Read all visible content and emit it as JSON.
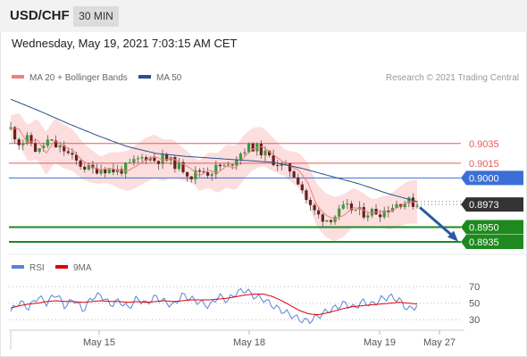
{
  "header": {
    "pair": "USD/CHF",
    "timeframe": "30 MIN",
    "datetime": "Wednesday, May 19, 2021 7:03:15 AM CET"
  },
  "legend": {
    "ma20": {
      "label": "MA 20 + Bollinger Bands",
      "color": "#f08080"
    },
    "ma50": {
      "label": "MA 50",
      "color": "#2c4f8c"
    },
    "rsi": {
      "label": "RSI",
      "color": "#5b82d8"
    },
    "rsi_ma": {
      "label": "9MA",
      "color": "#e00000"
    }
  },
  "credit": "Research © 2021 Trading Central",
  "chart_data": [
    {
      "type": "candlestick",
      "ylim": [
        0.8925,
        0.9092
      ],
      "x_labels": [
        "May 15",
        "May 18",
        "May 19",
        "May 27"
      ],
      "levels": [
        {
          "value": 0.9035,
          "label": "0.9035",
          "kind": "resistance",
          "color": "#e85a5a"
        },
        {
          "value": 0.9015,
          "label": "0.9015",
          "kind": "resistance",
          "color": "#e85a5a"
        },
        {
          "value": 0.9,
          "label": "0.9000",
          "kind": "pivot",
          "color": "#3b6fd6"
        },
        {
          "value": 0.895,
          "label": "0.8950",
          "kind": "target",
          "color": "#1e8a1e"
        },
        {
          "value": 0.8935,
          "label": "0.8935",
          "kind": "target",
          "color": "#1e8a1e"
        }
      ],
      "last_price": {
        "value": 0.8973,
        "label": "0.8973",
        "color": "#333333"
      },
      "close_path": [
        0.905,
        0.9035,
        0.904,
        0.9025,
        0.9038,
        0.9032,
        0.9028,
        0.9018,
        0.9012,
        0.9008,
        0.901,
        0.9008,
        0.9007,
        0.9012,
        0.9018,
        0.9022,
        0.9018,
        0.902,
        0.9015,
        0.901,
        0.9002,
        0.9008,
        0.9005,
        0.9012,
        0.901,
        0.9022,
        0.903,
        0.9032,
        0.9025,
        0.9018,
        0.9012,
        0.9008,
        0.8995,
        0.8972,
        0.8962,
        0.8958,
        0.8962,
        0.897,
        0.8968,
        0.8964,
        0.8966,
        0.8965,
        0.897,
        0.8975,
        0.8976,
        0.8973
      ],
      "ma50_path": [
        0.908,
        0.9068,
        0.9055,
        0.9043,
        0.9032,
        0.9025,
        0.9022,
        0.902,
        0.9018,
        0.9016,
        0.901,
        0.9002,
        0.8994,
        0.8984,
        0.8976
      ],
      "band_width": 0.0018,
      "projection": {
        "from": 0.897,
        "to": 0.8938
      }
    },
    {
      "type": "line",
      "name": "RSI panel",
      "ylim": [
        15,
        80
      ],
      "y_ticks": [
        {
          "value": 70,
          "label": "70"
        },
        {
          "value": 50,
          "label": "50"
        },
        {
          "value": 30,
          "label": "30"
        }
      ],
      "rsi": [
        40,
        52,
        44,
        58,
        50,
        62,
        46,
        55,
        41,
        57,
        60,
        48,
        53,
        44,
        56,
        49,
        58,
        52,
        47,
        60,
        55,
        51,
        46,
        59,
        53,
        63,
        66,
        58,
        55,
        47,
        41,
        36,
        30,
        28,
        34,
        40,
        45,
        50,
        44,
        52,
        48,
        55,
        58,
        54,
        42,
        47
      ],
      "rsi_ma": [
        44,
        47,
        49,
        50,
        52,
        53,
        52,
        52,
        51,
        52,
        53,
        52,
        52,
        51,
        52,
        51,
        52,
        53,
        52,
        53,
        54,
        54,
        54,
        55,
        56,
        58,
        60,
        61,
        61,
        58,
        53,
        47,
        41,
        37,
        36,
        38,
        41,
        44,
        46,
        47,
        48,
        49,
        50,
        51,
        50,
        49
      ]
    }
  ]
}
